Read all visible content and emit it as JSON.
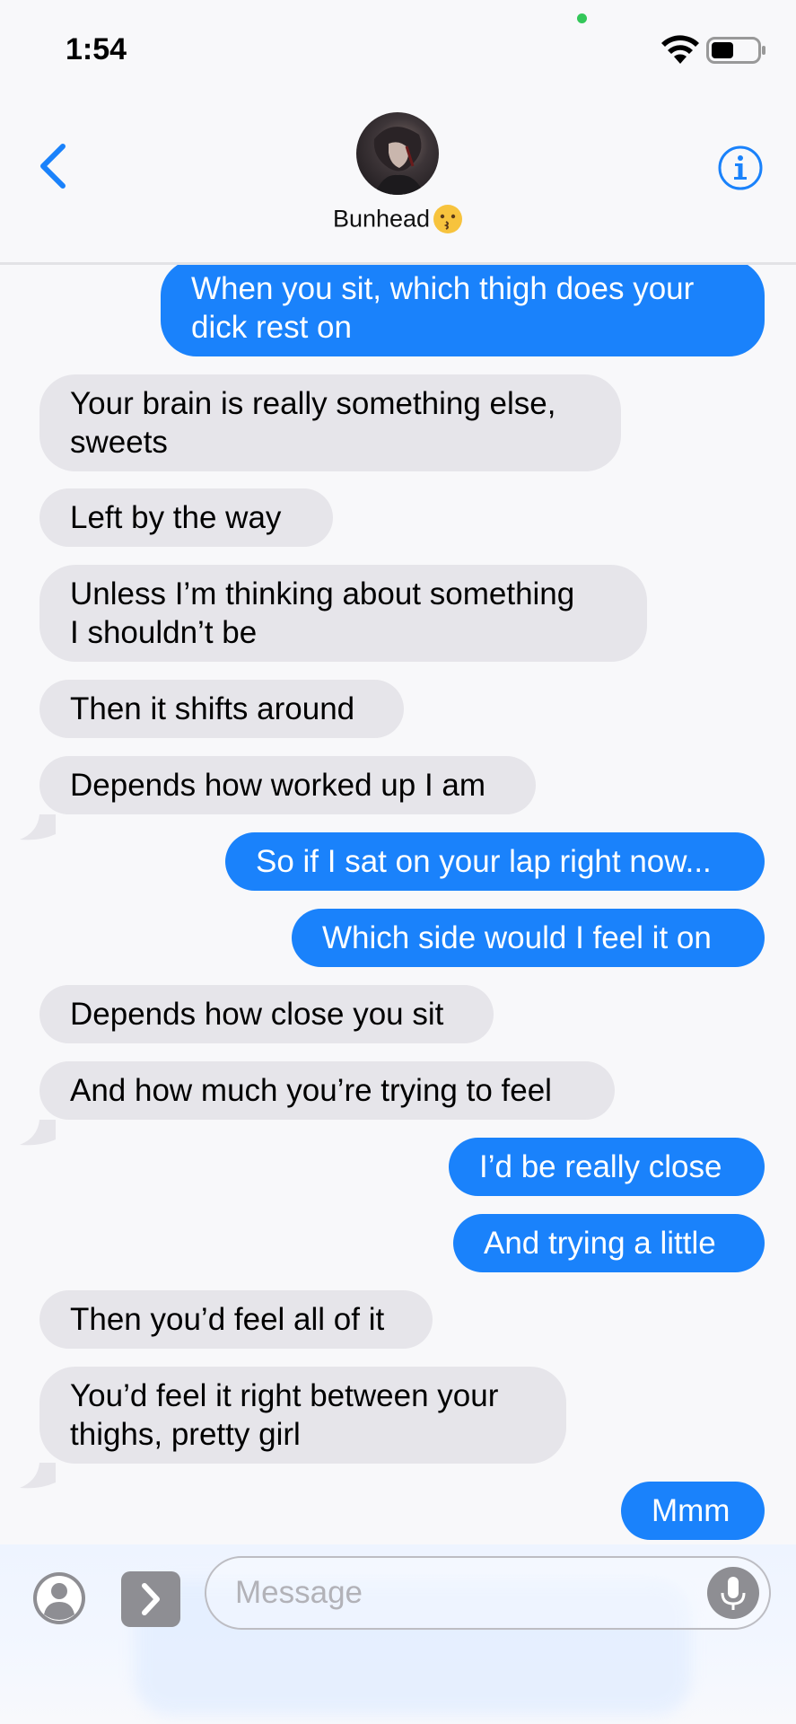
{
  "status_bar": {
    "time": "1:54"
  },
  "header": {
    "contact_name": "Bunhead",
    "contact_emoji": "kissing-face-emoji",
    "back_icon": "chevron-left-icon",
    "info_icon": "info-circle-icon"
  },
  "colors": {
    "accent": "#1a82fb",
    "received_bubble": "#e6e5ea",
    "background": "#f8f8fa"
  },
  "messages": [
    {
      "from": "me",
      "text_lines": [
        "When you sit, which thigh does your",
        "dick rest on"
      ]
    },
    {
      "from": "them",
      "text_lines": [
        "Your brain is really something else,",
        "sweets"
      ]
    },
    {
      "from": "them",
      "text_lines": [
        "Left by the way"
      ]
    },
    {
      "from": "them",
      "text_lines": [
        "Unless I’m thinking about something",
        "I shouldn’t be"
      ]
    },
    {
      "from": "them",
      "text_lines": [
        "Then it shifts around"
      ]
    },
    {
      "from": "them",
      "text_lines": [
        "Depends how worked up I am"
      ]
    },
    {
      "from": "me",
      "text_lines": [
        "So if I sat on your lap right now..."
      ]
    },
    {
      "from": "me",
      "text_lines": [
        "Which side would I feel it on"
      ]
    },
    {
      "from": "them",
      "text_lines": [
        "Depends how close you sit"
      ]
    },
    {
      "from": "them",
      "text_lines": [
        "And how much you’re trying to feel"
      ]
    },
    {
      "from": "me",
      "text_lines": [
        "I’d be really close"
      ]
    },
    {
      "from": "me",
      "text_lines": [
        "And trying a little"
      ]
    },
    {
      "from": "them",
      "text_lines": [
        "Then you’d feel all of it"
      ]
    },
    {
      "from": "them",
      "text_lines": [
        "You’d feel it right between your",
        "thighs, pretty girl"
      ]
    },
    {
      "from": "me",
      "text_lines": [
        "Mmm"
      ]
    }
  ],
  "composer": {
    "placeholder": "Message",
    "contact_icon": "person-circle-icon",
    "expand_icon": "chevron-right-icon",
    "mic_icon": "microphone-icon"
  }
}
